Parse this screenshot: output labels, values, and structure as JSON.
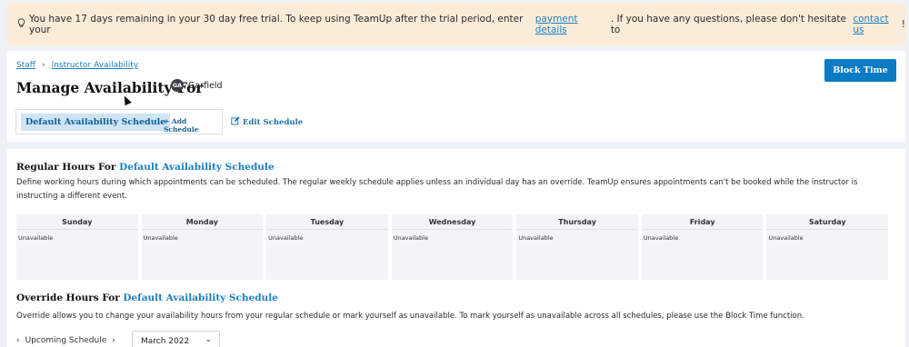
{
  "trial_banner": {
    "text_before": "You have 17 days remaining in your 30 day free trial. To keep using TeamUp after the trial period, enter your ",
    "link1": "payment details",
    "text_middle": ". If you have any questions, please don't hesitate to ",
    "link2": "contact us",
    "text_after": "!"
  },
  "breadcrumb": {
    "item1": "Staff",
    "separator": "›",
    "item2": "Instructor Availability"
  },
  "header": {
    "title": "Manage Availability For",
    "avatar_initials": "GA",
    "person_name": "Garfield",
    "block_time_label": "Block Time"
  },
  "schedules": {
    "active": "Default Availability Schedule",
    "add_label": "+ Add Schedule",
    "edit_label": "Edit Schedule"
  },
  "regular_hours": {
    "title_prefix": "Regular Hours For ",
    "title_highlight": "Default Availability Schedule",
    "description": "Define working hours during which appointments can be scheduled. The regular weekly schedule applies unless an individual day has an override. TeamUp ensures appointments can't be booked while the instructor is instructing a different event.",
    "days": [
      {
        "name": "Sunday",
        "value": "Unavailable"
      },
      {
        "name": "Monday",
        "value": "Unavailable"
      },
      {
        "name": "Tuesday",
        "value": "Unavailable"
      },
      {
        "name": "Wednesday",
        "value": "Unavailable"
      },
      {
        "name": "Thursday",
        "value": "Unavailable"
      },
      {
        "name": "Friday",
        "value": "Unavailable"
      },
      {
        "name": "Saturday",
        "value": "Unavailable"
      }
    ]
  },
  "override_hours": {
    "title_prefix": "Override Hours For ",
    "title_highlight": "Default Availability Schedule",
    "description": "Override allows you to change your availability hours from your regular schedule or mark yourself as unavailable. To mark yourself as unavailable across all schedules, please use the Block Time function.",
    "upcoming_label": "Upcoming Schedule",
    "prev": "‹",
    "next": "›",
    "month_value": "March 2022",
    "month_chevron": "⌄"
  },
  "colors": {
    "accent": "#0b7bc4",
    "banner_bg": "#fbecd9",
    "page_bg": "#eef1f5"
  },
  "icons": {
    "banner": "lightbulb-icon",
    "edit": "edit-icon"
  }
}
